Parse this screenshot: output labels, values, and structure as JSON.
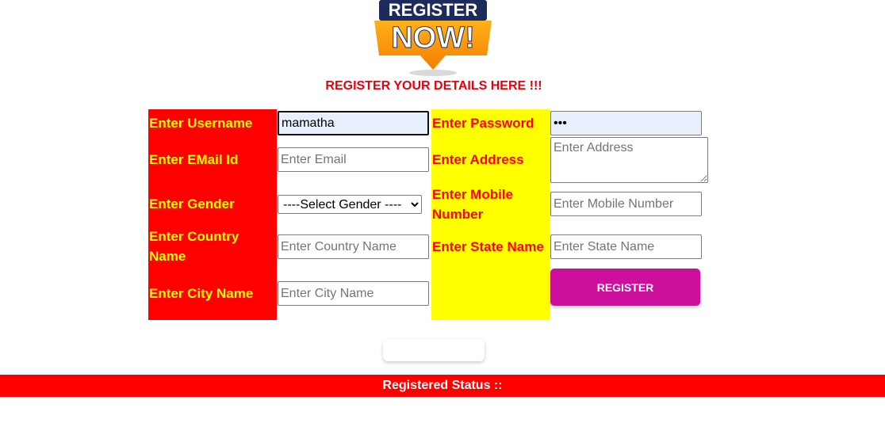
{
  "logo": {
    "line1": "REGISTER",
    "line2": "NOW!"
  },
  "heading": "REGISTER YOUR DETAILS HERE !!!",
  "left_labels": {
    "username": "Enter Username",
    "email": "Enter EMail Id",
    "gender": "Enter Gender",
    "country": "Enter Country Name",
    "city": "Enter City Name"
  },
  "right_labels": {
    "password": "Enter Password",
    "address": "Enter Address",
    "mobile": "Enter Mobile Number",
    "state": "Enter State Name"
  },
  "fields": {
    "username_value": "mamatha",
    "password_value": "•••",
    "email_placeholder": "Enter Email",
    "address_placeholder": "Enter Address",
    "mobile_placeholder": "Enter Mobile Number",
    "country_placeholder": "Enter Country Name",
    "state_placeholder": "Enter State Name",
    "city_placeholder": "Enter City Name",
    "gender_selected": "----Select Gender ----"
  },
  "buttons": {
    "register": "REGISTER"
  },
  "status": {
    "label": "Registered Status ::"
  },
  "colors": {
    "label_column_1": "#ff0000",
    "label_column_2": "#ffff00",
    "register_button": "#cc0f9c",
    "status_bar": "#ff0000"
  }
}
